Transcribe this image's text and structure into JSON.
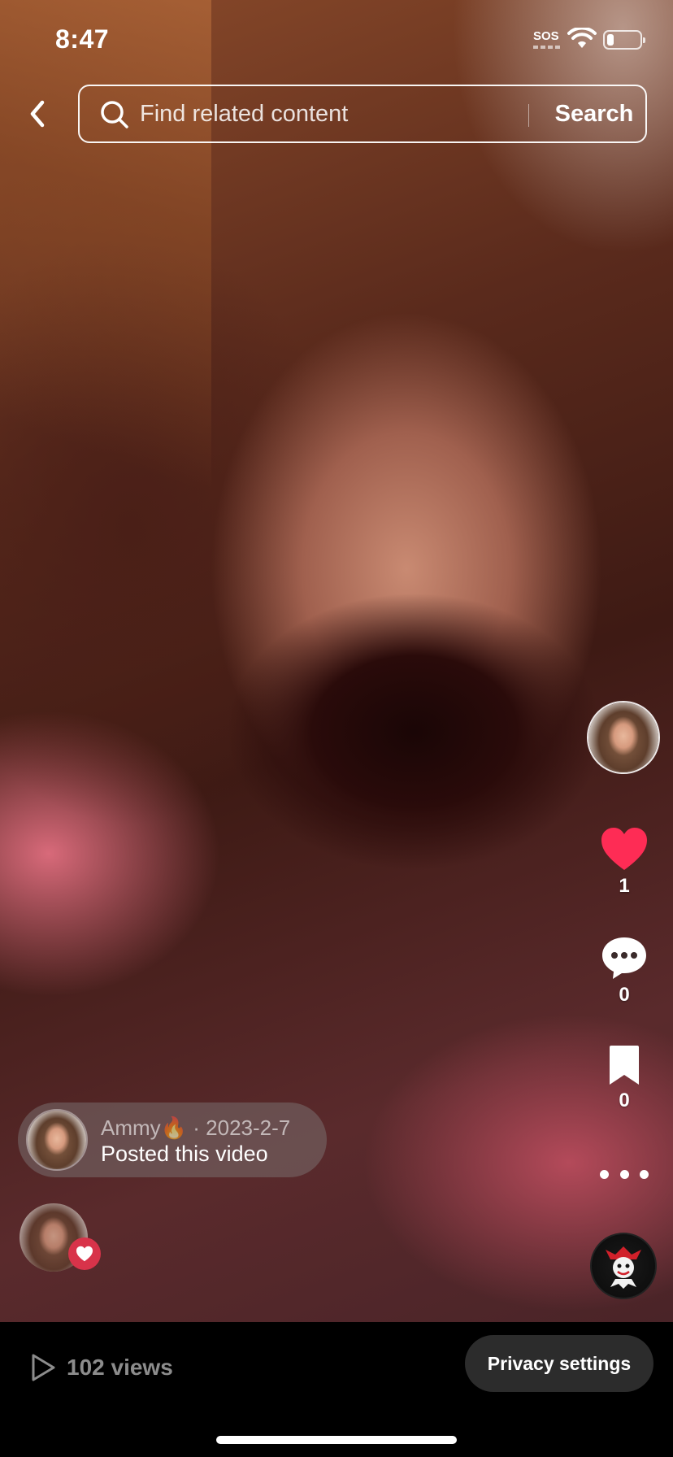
{
  "status_bar": {
    "time": "8:47",
    "sos_label": "SOS",
    "battery_level": 0.15
  },
  "header": {
    "search_placeholder": "Find related content",
    "search_button_label": "Search"
  },
  "rail": {
    "like_count": "1",
    "comment_count": "0",
    "bookmark_count": "0",
    "like_color": "#FE2C55"
  },
  "posted": {
    "username": "Ammy🔥",
    "date": "· 2023-2-7",
    "action_text": "Posted this video"
  },
  "bottom_bar": {
    "views_text": "102 views",
    "privacy_button_label": "Privacy settings"
  },
  "icons": {
    "back": "chevron-left-icon",
    "search": "search-icon",
    "like": "heart-icon",
    "comment": "comment-icon",
    "bookmark": "bookmark-icon",
    "more": "more-horizontal-icon",
    "views": "play-icon"
  }
}
